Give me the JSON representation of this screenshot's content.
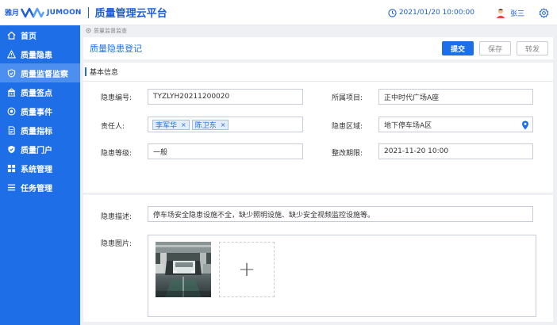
{
  "header": {
    "logo_cn": "雅月",
    "logo_en": "JUMOON",
    "app_title": "质量管理云平台",
    "datetime": "2021/01/20 10:00:00",
    "username": "张三",
    "icons": [
      "clock-icon",
      "avatar",
      "settings-icon"
    ],
    "accent_color": "#1f5fd6"
  },
  "sidebar": {
    "bg_color": "#1e6ee8",
    "items": [
      {
        "label": "首页",
        "icon": "home-icon",
        "active": false
      },
      {
        "label": "质量隐患",
        "icon": "warning-icon",
        "active": false
      },
      {
        "label": "质量监督监察",
        "icon": "shield-icon",
        "active": true
      },
      {
        "label": "质量签点",
        "icon": "building-icon",
        "active": false
      },
      {
        "label": "质量事件",
        "icon": "target-icon",
        "active": false
      },
      {
        "label": "质量指标",
        "icon": "document-icon",
        "active": false
      },
      {
        "label": "质量门户",
        "icon": "shield-check-icon",
        "active": false
      },
      {
        "label": "系统管理",
        "icon": "grid-icon",
        "active": false
      },
      {
        "label": "任务管理",
        "icon": "list-icon",
        "active": false
      }
    ]
  },
  "breadcrumb": "质量监督监查",
  "page": {
    "title": "质量隐患登记",
    "buttons": {
      "submit": "提交",
      "save": "保存",
      "forward": "转发"
    }
  },
  "form": {
    "section_title": "基本信息",
    "id_label": "隐患编号:",
    "id_value": "TYZLYH20211200020",
    "project_label": "所属项目:",
    "project_value": "正中时代广场A座",
    "owner_label": "责任人:",
    "owners": [
      "李军华",
      "陈卫东"
    ],
    "tag_close": "×",
    "area_label": "隐患区域:",
    "area_value": "地下停车场A区",
    "level_label": "隐患等级:",
    "level_value": "一般",
    "deadline_label": "整改期限:",
    "deadline_value": "2021-11-20  10:00",
    "desc_label": "隐患描述:",
    "desc_value": "停车场安全隐患设施不全，缺少照明设施、缺少安全视频监控设施等。",
    "images_label": "隐患图片:",
    "upload_symbol": "+"
  }
}
